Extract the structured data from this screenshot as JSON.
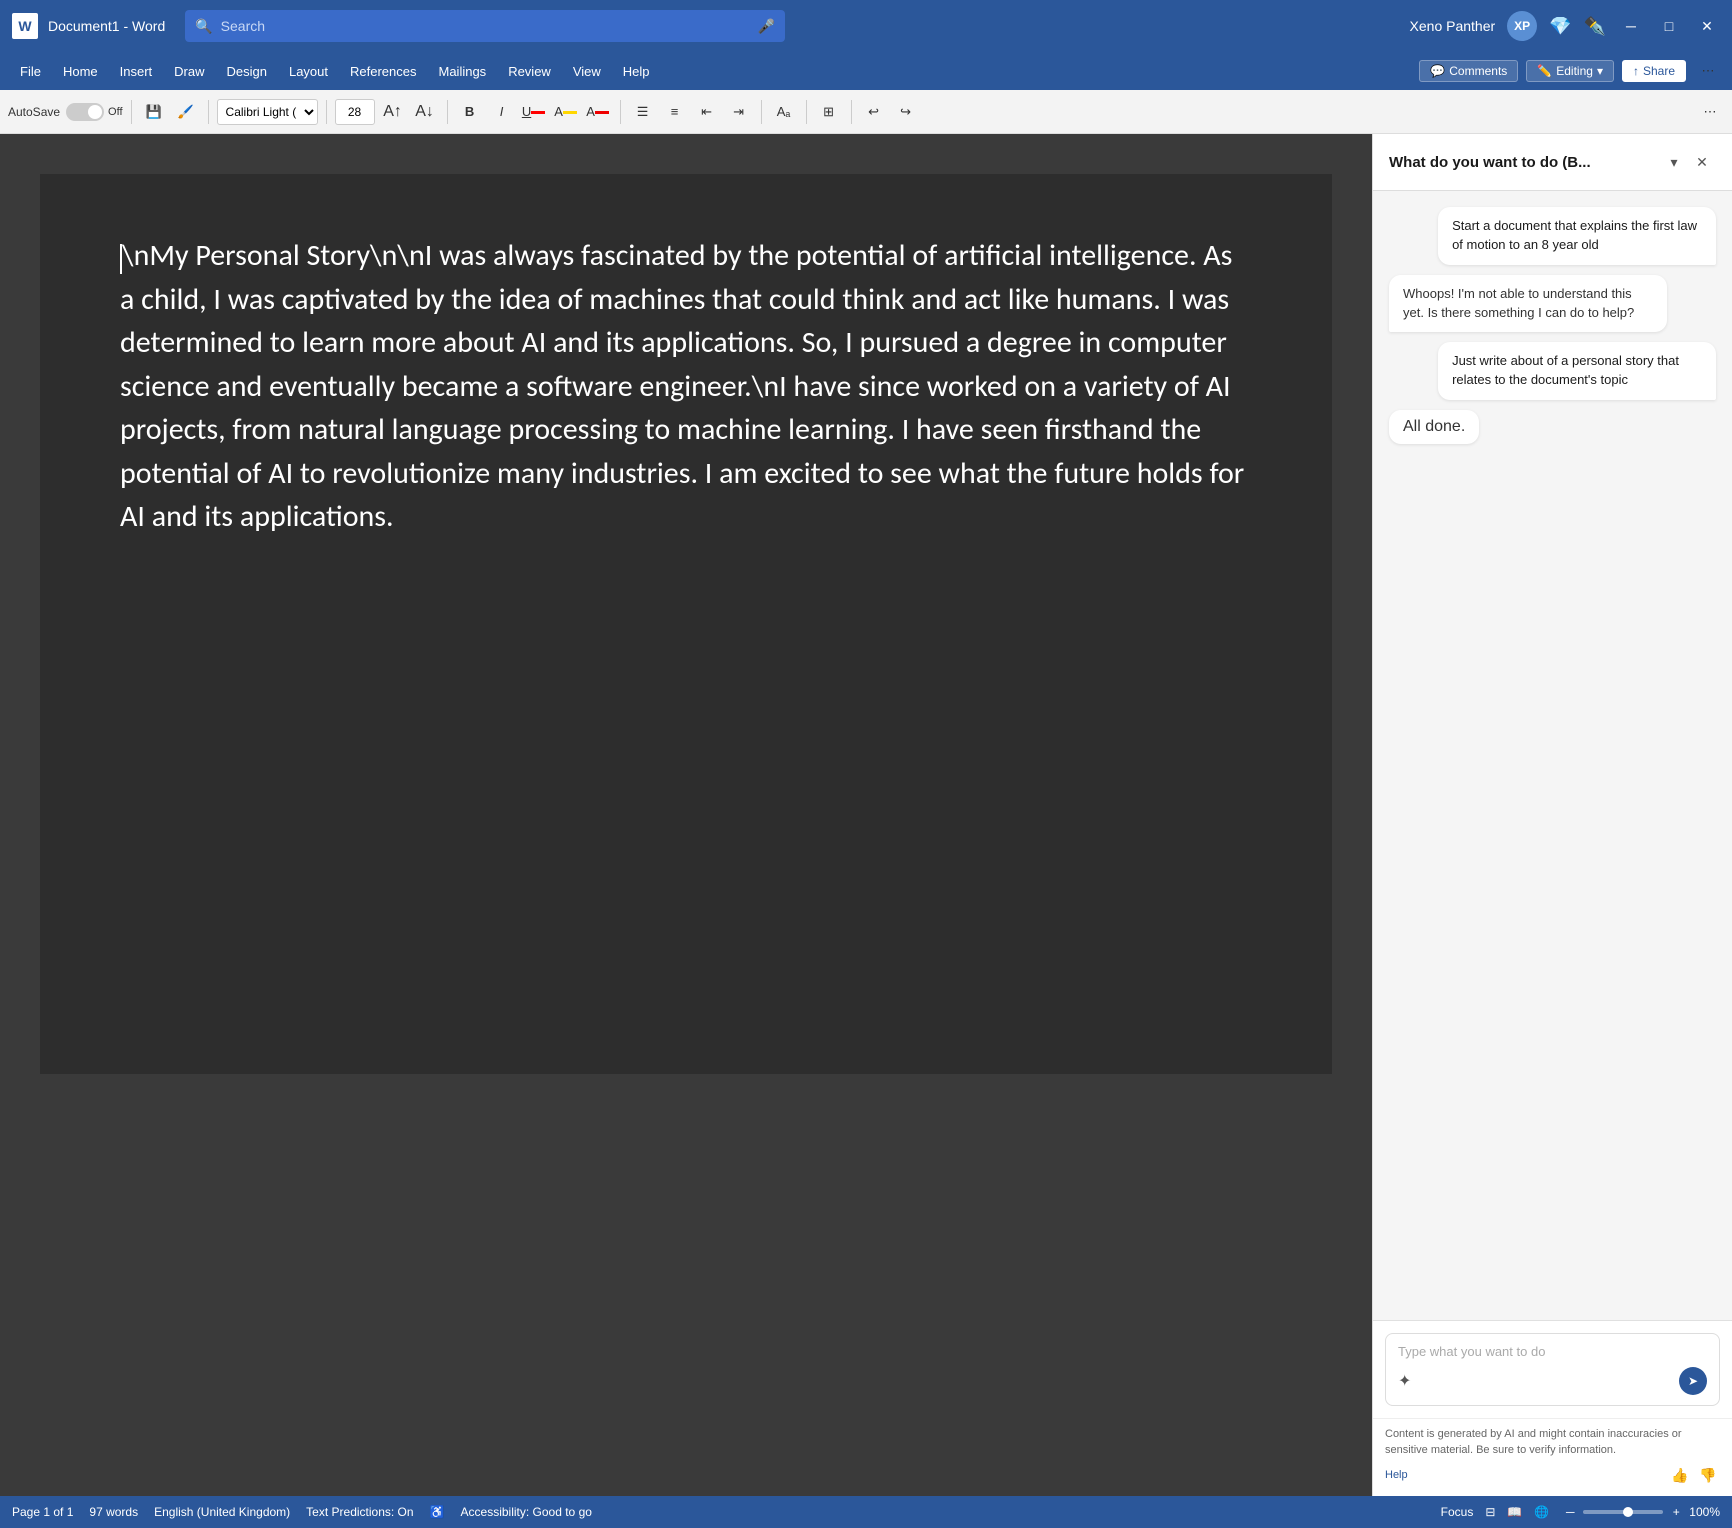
{
  "titlebar": {
    "word_icon": "W",
    "doc_title": "Document1 - Word",
    "search_placeholder": "Search",
    "user_name": "Xeno Panther",
    "avatar_initials": "XP",
    "minimize_icon": "─",
    "maximize_icon": "□",
    "close_icon": "✕"
  },
  "menubar": {
    "items": [
      "File",
      "Home",
      "Insert",
      "Draw",
      "Design",
      "Layout",
      "References",
      "Mailings",
      "Review",
      "View",
      "Help"
    ],
    "comments_label": "Comments",
    "editing_label": "Editing",
    "share_label": "Share"
  },
  "toolbar": {
    "autosave_label": "AutoSave",
    "toggle_state": "Off",
    "font_name": "Calibri Light (",
    "font_size": "28",
    "bold": "B",
    "italic": "I",
    "underline": "U",
    "undo": "↩",
    "redo": "↪"
  },
  "document": {
    "content": "\\nMy Personal Story\\n\\nI was always fascinated by the potential of artificial intelligence. As a child, I was captivated by the idea of machines that could think and act like humans. I was determined to learn more about AI and its applications. So, I pursued a degree in computer science and eventually became a software engineer.\\nI have since worked on a variety of AI projects, from natural language processing to machine learning. I have seen firsthand the potential of AI to revolutionize many industries. I am excited to see what the future holds for AI and its applications."
  },
  "sidebar": {
    "title": "What do you want to do (B...",
    "messages": [
      {
        "type": "user",
        "text": "Start a document that explains the first law of motion to an 8 year old"
      },
      {
        "type": "ai",
        "text": "Whoops! I'm not able to understand this yet. Is there something I can do to help?"
      },
      {
        "type": "user",
        "text": "Just write about of a personal story that relates to the document's topic"
      },
      {
        "type": "done",
        "text": "All done."
      }
    ],
    "input_placeholder": "Type what you want to do",
    "disclaimer_text": "Content is generated by AI and might contain inaccuracies or sensitive material. Be sure to verify information.",
    "help_label": "Help"
  },
  "statusbar": {
    "page_info": "Page 1 of 1",
    "word_count": "97 words",
    "language": "English (United Kingdom)",
    "text_predictions": "Text Predictions: On",
    "accessibility": "Accessibility: Good to go",
    "focus_label": "Focus",
    "zoom_level": "100%"
  }
}
